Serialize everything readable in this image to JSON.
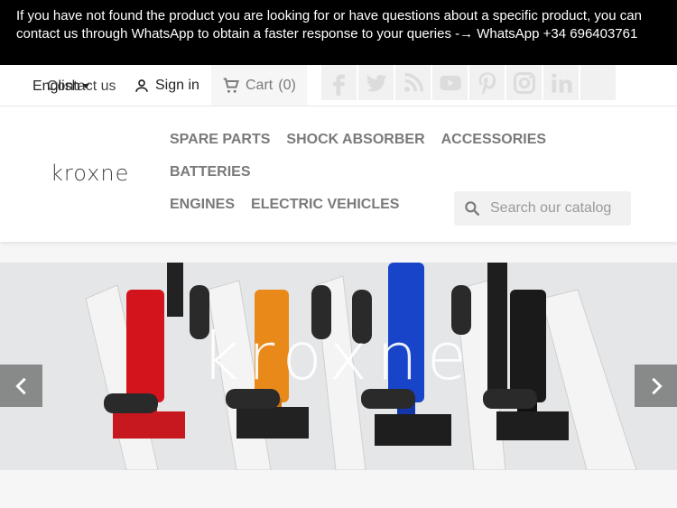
{
  "banner": {
    "line1": "If you have not found the product you are looking for or have questions about a specific product, you can",
    "line2": "contact us through WhatsApp to obtain a faster response to your queries -→ WhatsApp +34 696403761"
  },
  "nav": {
    "language": "English",
    "contact": "Contact us",
    "signin": "Sign in",
    "cart": "Cart",
    "cart_count": "(0)"
  },
  "socials": [
    "facebook-icon",
    "twitter-icon",
    "rss-icon",
    "youtube-icon",
    "pinterest-icon",
    "instagram-icon",
    "linkedin-icon",
    "blank"
  ],
  "brand": {
    "logo_text": "kroxne"
  },
  "menu": {
    "items": [
      "SPARE PARTS",
      "SHOCK ABSORBER",
      "ACCESSORIES",
      "BATTERIES",
      "ENGINES",
      "ELECTRIC VEHICLES"
    ]
  },
  "search": {
    "placeholder": "Search our catalog"
  },
  "slider": {
    "title": "kroxne"
  },
  "colors": {
    "banner_bg": "#000000",
    "shock_red": "#d4141d",
    "shock_orange": "#e8891a",
    "shock_blue": "#1744c9",
    "shock_black": "#1a1a1a"
  }
}
